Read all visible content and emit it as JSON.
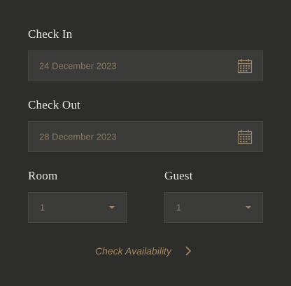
{
  "check_in": {
    "label": "Check In",
    "value": "24 December 2023"
  },
  "check_out": {
    "label": "Check Out",
    "value": "28 December 2023"
  },
  "room": {
    "label": "Room",
    "selected": "1"
  },
  "guest": {
    "label": "Guest",
    "selected": "1"
  },
  "cta": {
    "label": "Check Availability"
  },
  "icons": {
    "calendar": "calendar-icon",
    "caret": "chevron-down-icon",
    "arrow": "chevron-right-icon"
  },
  "colors": {
    "background": "#2d2d2c",
    "field": "#3b3b39",
    "accent": "#a88a63",
    "label": "#e9e6df"
  }
}
